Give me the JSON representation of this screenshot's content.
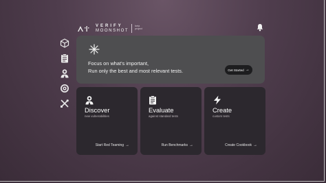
{
  "header": {
    "brand_top": "VERIFY",
    "brand_bottom": "MOONSHOT",
    "beta_line1": "beta",
    "beta_line2": "project",
    "notification_icon": "bell-icon"
  },
  "sidebar": {
    "items": [
      {
        "icon": "cube-icon"
      },
      {
        "icon": "clipboard-icon"
      },
      {
        "icon": "red-team-icon"
      },
      {
        "icon": "target-icon"
      },
      {
        "icon": "tools-icon"
      }
    ]
  },
  "banner": {
    "icon": "sparkle-icon",
    "line1": "Focus on what's important,",
    "line2": "Run only the best and most relevant tests.",
    "button_label": "Get Started",
    "button_arrow": "→"
  },
  "cards": [
    {
      "icon": "red-team-icon",
      "title": "Discover",
      "subtitle": "new vulnerabilities",
      "link": "Start Red Teaming",
      "arrow": "→"
    },
    {
      "icon": "clipboard-icon",
      "title": "Evaluate",
      "subtitle": "against standard tests",
      "link": "Run Benchmarks",
      "arrow": "→"
    },
    {
      "icon": "lightning-icon",
      "title": "Create",
      "subtitle": "custom tests",
      "link": "Create Cookbook",
      "arrow": "→"
    }
  ],
  "colors": {
    "background": "#4f3d4d",
    "banner": "#4e4e50",
    "card": "#2c282e",
    "button": "#1d1d1f"
  }
}
